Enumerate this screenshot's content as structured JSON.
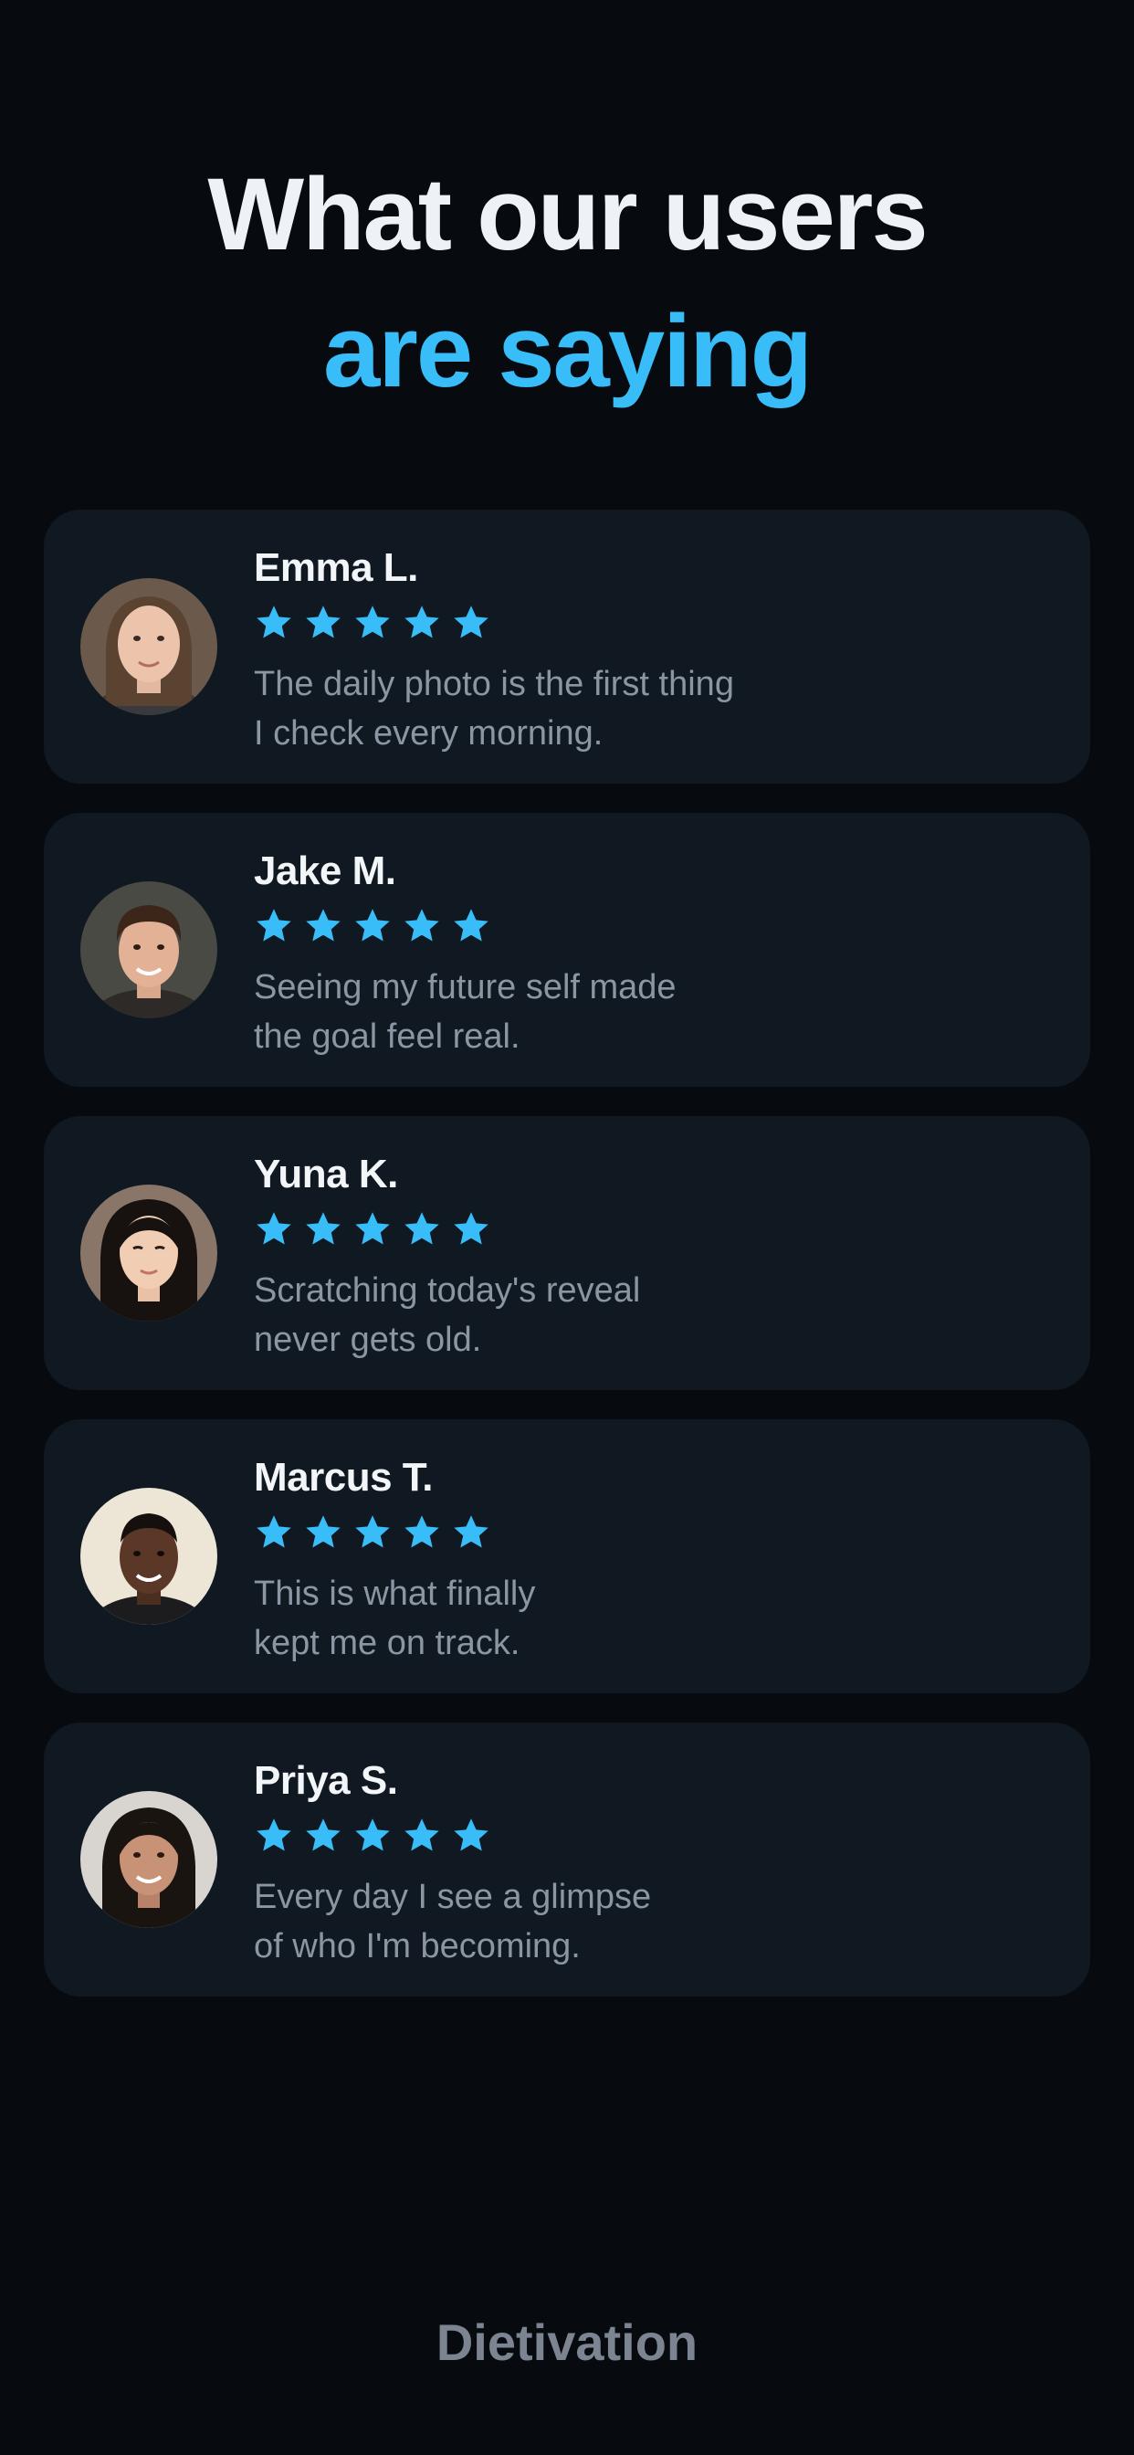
{
  "header": {
    "line1": "What our users",
    "line2": "are saying"
  },
  "colors": {
    "background": "#070b10",
    "card": "#101821",
    "accent": "#38bdf8",
    "name": "#f3f6f9",
    "quote": "#8b96a3",
    "brand": "#7b8490"
  },
  "testimonials": [
    {
      "name": "Emma L.",
      "rating": 5,
      "quote_line1": "The daily photo is the first thing",
      "quote_line2": "I check every morning.",
      "avatar_icon": "avatar-photo-woman"
    },
    {
      "name": "Jake M.",
      "rating": 5,
      "quote_line1": "Seeing my future self made",
      "quote_line2": "the goal feel real.",
      "avatar_icon": "avatar-photo-man"
    },
    {
      "name": "Yuna K.",
      "rating": 5,
      "quote_line1": "Scratching today's reveal",
      "quote_line2": "never gets old.",
      "avatar_icon": "avatar-photo-woman"
    },
    {
      "name": "Marcus T.",
      "rating": 5,
      "quote_line1": "This is what finally",
      "quote_line2": "kept me on track.",
      "avatar_icon": "avatar-photo-man"
    },
    {
      "name": "Priya S.",
      "rating": 5,
      "quote_line1": "Every day I see a glimpse",
      "quote_line2": "of who I'm becoming.",
      "avatar_icon": "avatar-photo-woman"
    }
  ],
  "star_icon": "star-icon",
  "footer": {
    "brand": "Dietivation"
  }
}
